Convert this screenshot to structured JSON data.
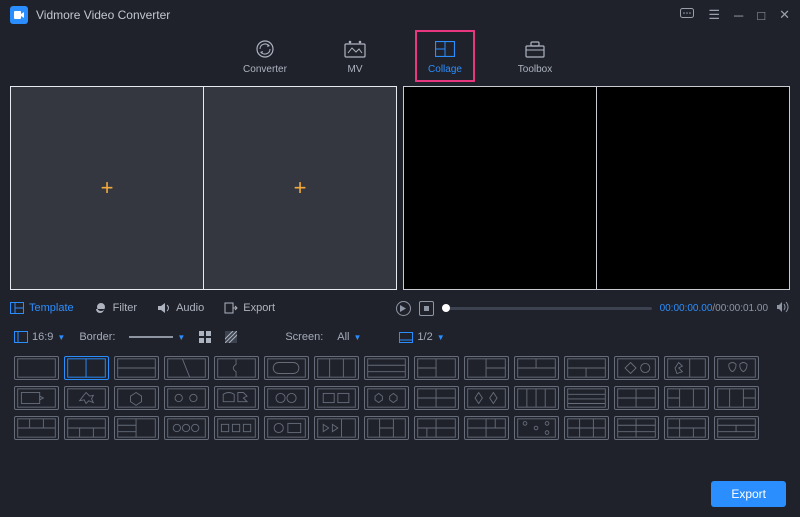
{
  "app": {
    "title": "Vidmore Video Converter"
  },
  "nav": {
    "converter": "Converter",
    "mv": "MV",
    "collage": "Collage",
    "toolbox": "Toolbox"
  },
  "tabs": {
    "template": "Template",
    "filter": "Filter",
    "audio": "Audio",
    "export": "Export"
  },
  "player": {
    "current": "00:00:00.00",
    "sep": "/",
    "total": "00:00:01.00"
  },
  "controls": {
    "ratio": "16:9",
    "border_label": "Border:",
    "screen_label": "Screen:",
    "screen_value": "All",
    "split": "1/2"
  },
  "footer": {
    "export": "Export"
  }
}
